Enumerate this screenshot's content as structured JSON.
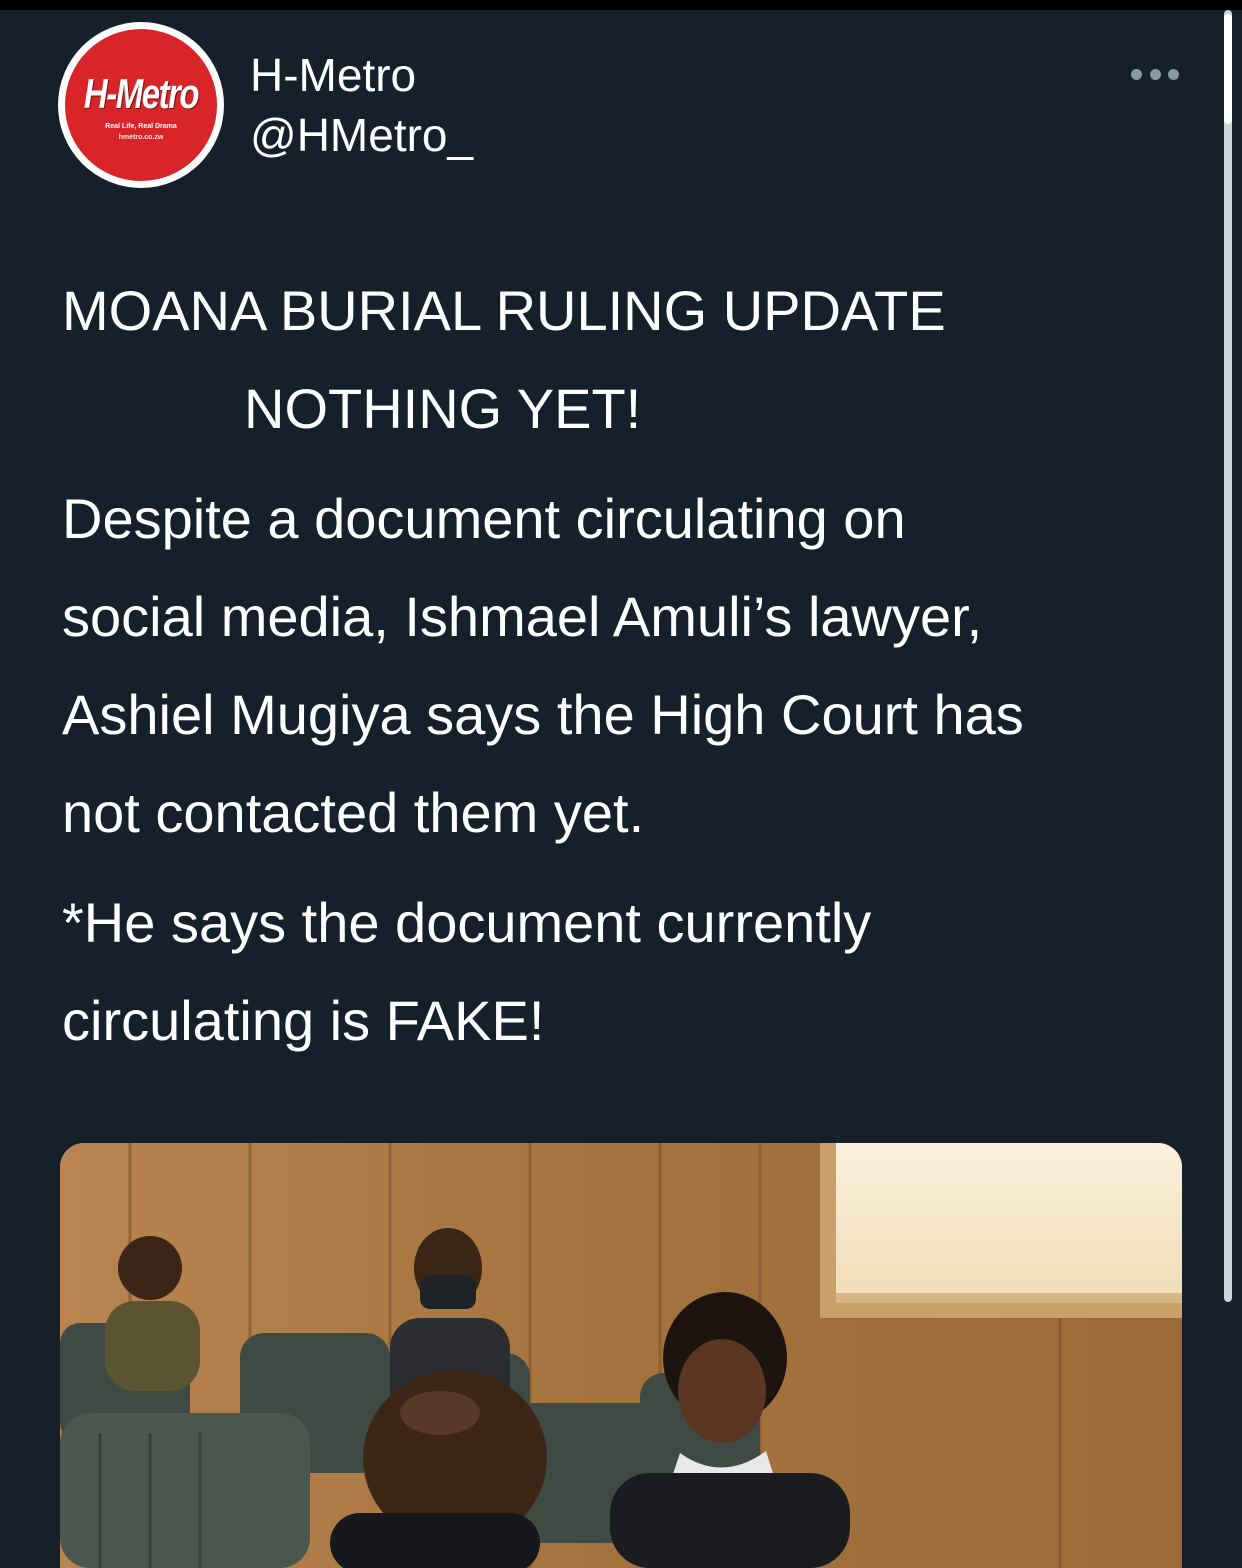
{
  "account": {
    "display_name": "H-Metro",
    "handle": "@HMetro_",
    "avatar": {
      "logo_text": "H-Metro",
      "tagline": "Real Life, Real Drama",
      "url": "hmetro.co.zw",
      "brand_color": "#d9252a"
    }
  },
  "menu": {
    "icon": "more-horizontal-icon"
  },
  "tweet": {
    "headline_line1": "MOANA BURIAL RULING UPDATE",
    "headline_line2": "NOTHING YET!",
    "body_lines": [
      "Despite a document circulating on",
      "social media, Ishmael Amuli’s lawyer,",
      "Ashiel Mugiya says the High Court has",
      "not contacted them yet."
    ],
    "note_lines": [
      "*He says the document currently",
      "circulating is FAKE!"
    ]
  },
  "colors": {
    "background": "#15202b",
    "text": "#ffffff",
    "muted": "#8899a6"
  }
}
